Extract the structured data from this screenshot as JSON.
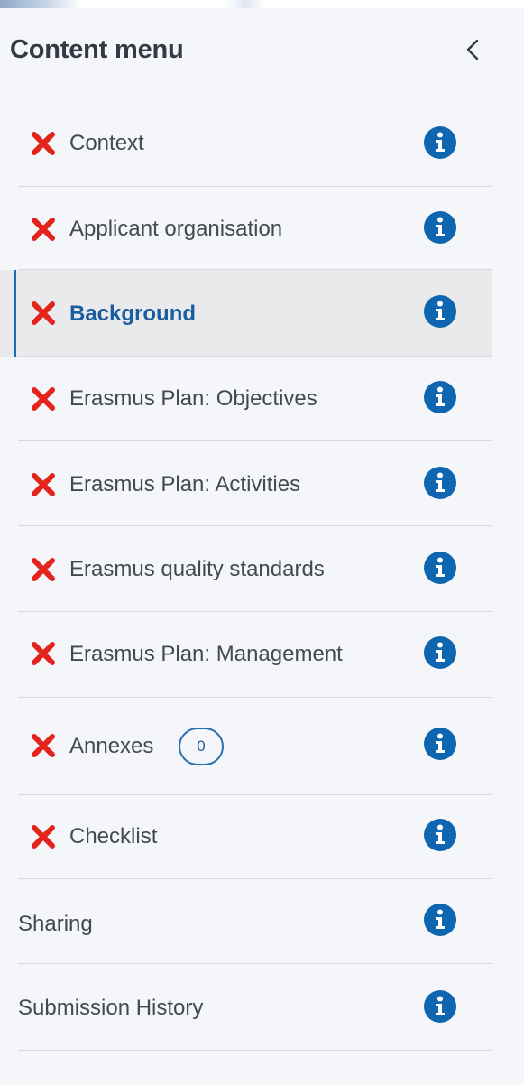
{
  "header": {
    "title": "Content menu",
    "collapse_icon": "chevron-left-icon"
  },
  "colors": {
    "background": "#f4f6fa",
    "active_bg": "#e9eaec",
    "active_accent": "#1f6cb0",
    "active_text": "#1a5d9e",
    "error_x": "#e3231c",
    "info_icon": "#0e65b0"
  },
  "menu": {
    "items": [
      {
        "label": "Context",
        "status": "incomplete",
        "status_icon": "red-x-icon",
        "info_icon": "info-circle-icon"
      },
      {
        "label": "Applicant organisation",
        "status": "incomplete",
        "status_icon": "red-x-icon",
        "info_icon": "info-circle-icon"
      },
      {
        "label": "Background",
        "status": "incomplete",
        "status_icon": "red-x-icon",
        "info_icon": "info-circle-icon",
        "active": true
      },
      {
        "label": "Erasmus Plan: Objectives",
        "status": "incomplete",
        "status_icon": "red-x-icon",
        "info_icon": "info-circle-icon"
      },
      {
        "label": "Erasmus Plan: Activities",
        "status": "incomplete",
        "status_icon": "red-x-icon",
        "info_icon": "info-circle-icon"
      },
      {
        "label": "Erasmus quality standards",
        "status": "incomplete",
        "status_icon": "red-x-icon",
        "info_icon": "info-circle-icon"
      },
      {
        "label": "Erasmus Plan: Management",
        "status": "incomplete",
        "status_icon": "red-x-icon",
        "info_icon": "info-circle-icon"
      },
      {
        "label": "Annexes",
        "status": "incomplete",
        "status_icon": "red-x-icon",
        "info_icon": "info-circle-icon",
        "badge": "0"
      },
      {
        "label": "Checklist",
        "status": "incomplete",
        "status_icon": "red-x-icon",
        "info_icon": "info-circle-icon"
      },
      {
        "label": "Sharing",
        "info_icon": "info-circle-icon"
      },
      {
        "label": "Submission History",
        "info_icon": "info-circle-icon"
      }
    ]
  }
}
